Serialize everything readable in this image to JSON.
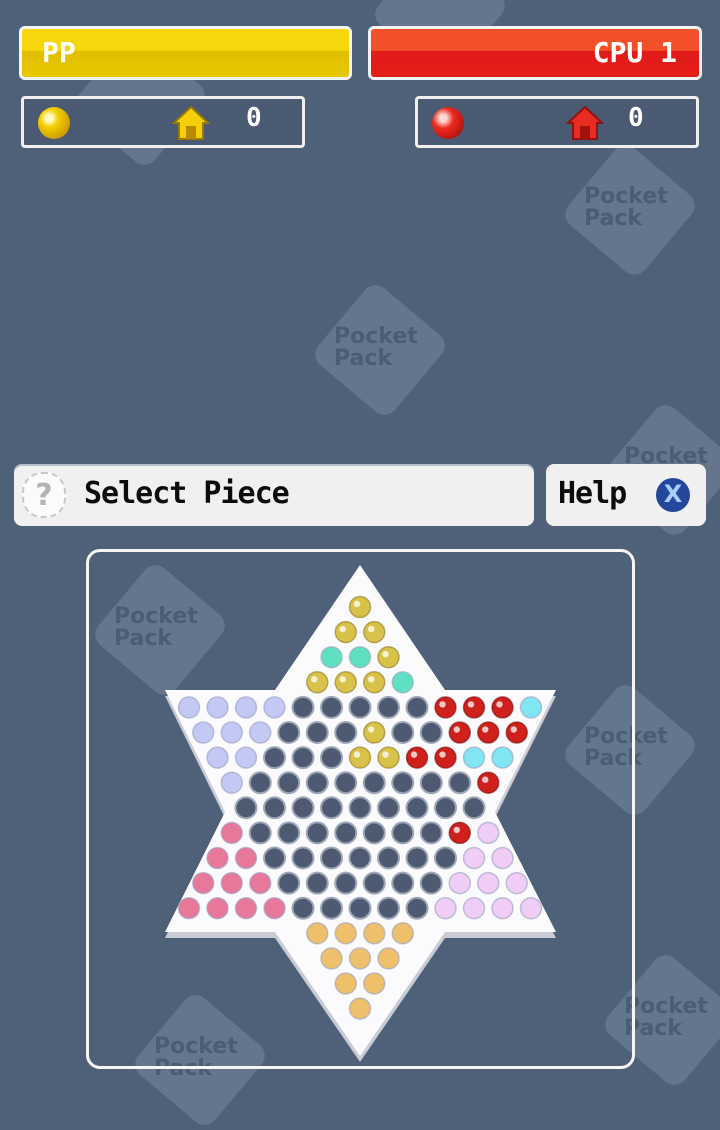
{
  "players": [
    {
      "name": "PP",
      "color": "#f5d70c",
      "piece": "gold",
      "home_count": "0"
    },
    {
      "name": "CPU 1",
      "color": "#e51d17",
      "piece": "red",
      "home_count": "0"
    }
  ],
  "status": {
    "message": "Select Piece",
    "help_label": "Help",
    "help_button_glyph": "X"
  },
  "watermark": "Pocket Pack",
  "palette": {
    "gold": "#d9c24a",
    "teal": "#5fe0c0",
    "lavender": "#c3c8f4",
    "red": "#d0201c",
    "cyan": "#7fe6f2",
    "pink": "#e8789a",
    "lilac": "#efcdf4",
    "tan": "#eec06c",
    "empty": "#4d5a72"
  },
  "board": {
    "rows": [
      [
        "gold"
      ],
      [
        "gold",
        "gold"
      ],
      [
        "teal",
        "teal",
        "gold"
      ],
      [
        "gold",
        "gold",
        "gold",
        "teal"
      ],
      [
        "lavender",
        "lavender",
        "lavender",
        "lavender",
        "empty",
        "empty",
        "empty",
        "empty",
        "empty",
        "red",
        "red",
        "red",
        "cyan"
      ],
      [
        "lavender",
        "lavender",
        "lavender",
        "empty",
        "empty",
        "empty",
        "gold",
        "empty",
        "empty",
        "red",
        "red",
        "red"
      ],
      [
        "lavender",
        "lavender",
        "empty",
        "empty",
        "empty",
        "gold",
        "gold",
        "red",
        "red",
        "cyan",
        "cyan"
      ],
      [
        "lavender",
        "empty",
        "empty",
        "empty",
        "empty",
        "empty",
        "empty",
        "empty",
        "empty",
        "red"
      ],
      [
        "empty",
        "empty",
        "empty",
        "empty",
        "empty",
        "empty",
        "empty",
        "empty",
        "empty"
      ],
      [
        "pink",
        "empty",
        "empty",
        "empty",
        "empty",
        "empty",
        "empty",
        "empty",
        "red",
        "lilac"
      ],
      [
        "pink",
        "pink",
        "empty",
        "empty",
        "empty",
        "empty",
        "empty",
        "empty",
        "empty",
        "lilac",
        "lilac"
      ],
      [
        "pink",
        "pink",
        "pink",
        "empty",
        "empty",
        "empty",
        "empty",
        "empty",
        "empty",
        "lilac",
        "lilac",
        "lilac"
      ],
      [
        "pink",
        "pink",
        "pink",
        "pink",
        "empty",
        "empty",
        "empty",
        "empty",
        "empty",
        "lilac",
        "lilac",
        "lilac",
        "lilac"
      ],
      [
        "tan",
        "tan",
        "tan",
        "tan"
      ],
      [
        "tan",
        "tan",
        "tan"
      ],
      [
        "tan",
        "tan"
      ],
      [
        "tan"
      ]
    ]
  }
}
